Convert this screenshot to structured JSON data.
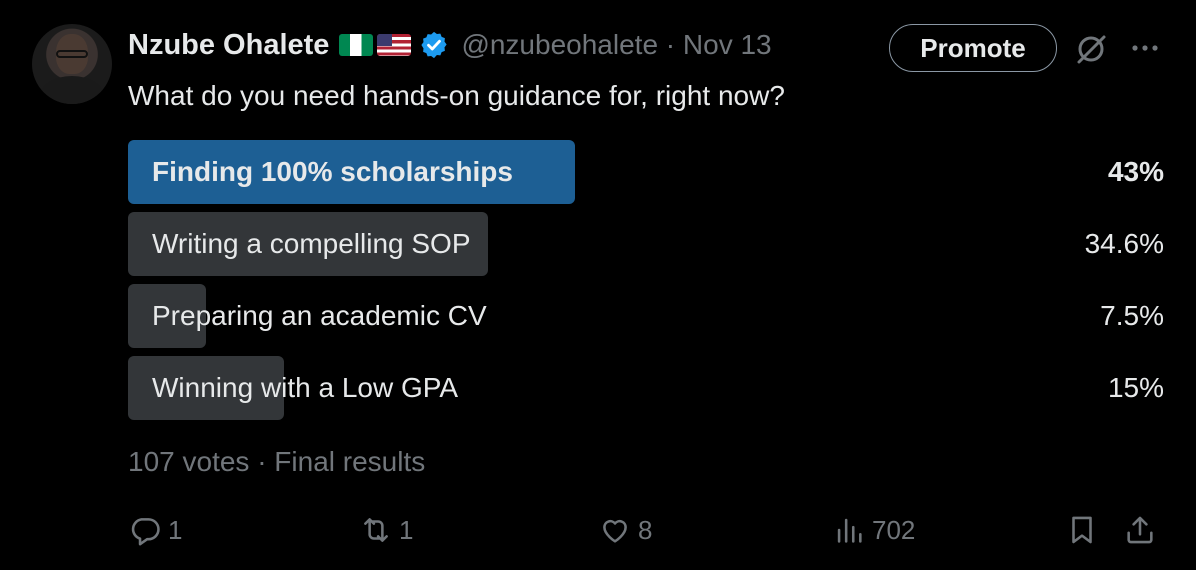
{
  "tweet": {
    "author_name": "Nzube Ohalete",
    "handle_date": "@nzubeohalete · Nov 13",
    "question": "What do you need hands-on guidance for, right now?",
    "promote_label": "Promote"
  },
  "poll": {
    "options": [
      {
        "label": "Finding 100% scholarships",
        "percent_text": "43%",
        "fraction": 0.43
      },
      {
        "label": "Writing a compelling SOP",
        "percent_text": "34.6%",
        "fraction": 0.346
      },
      {
        "label": "Preparing an academic CV",
        "percent_text": "7.5%",
        "fraction": 0.075
      },
      {
        "label": "Winning with a Low GPA",
        "percent_text": "15%",
        "fraction": 0.15
      }
    ],
    "footer": "107 votes · Final results"
  },
  "actions": {
    "replies": "1",
    "reposts": "1",
    "likes": "8",
    "views": "702"
  },
  "colors": {
    "background": "#000000",
    "winner_bar": "#1d5f94",
    "bar": "#333639",
    "muted_text": "#71767b",
    "verified_badge": "#1d9bf0"
  },
  "icons": [
    "verified-badge-icon",
    "grok-icon",
    "more-icon",
    "reply-icon",
    "repost-icon",
    "like-icon",
    "views-icon",
    "bookmark-icon",
    "share-icon"
  ]
}
